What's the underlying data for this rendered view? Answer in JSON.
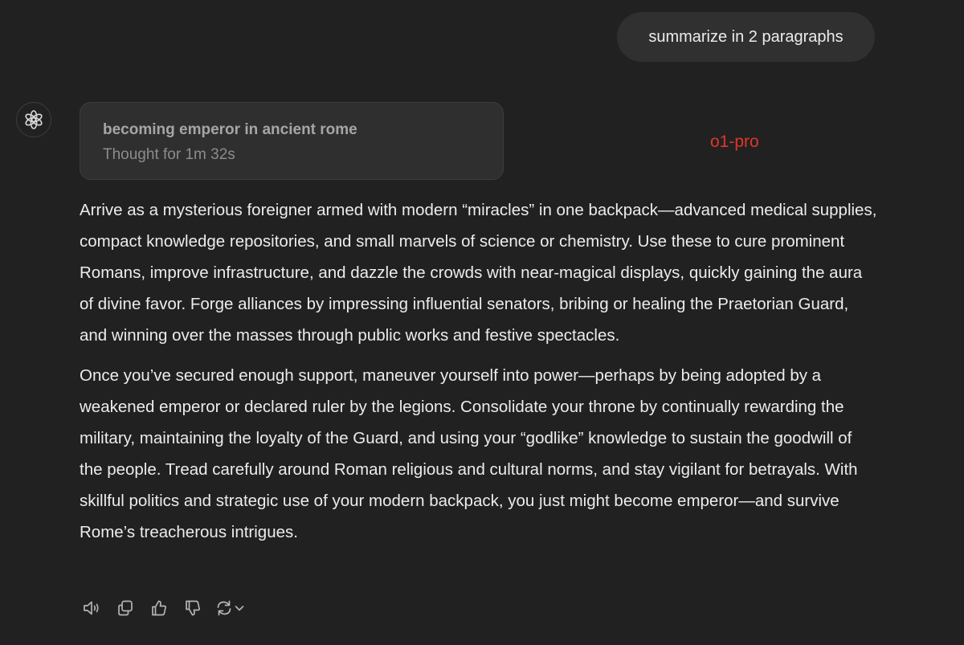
{
  "user_message": {
    "text": "summarize in 2 paragraphs"
  },
  "assistant": {
    "avatar_icon": "openai-logo-icon",
    "model_label": "o1-pro",
    "thought": {
      "title": "becoming emperor in ancient rome",
      "subtitle": "Thought for 1m 32s"
    },
    "paragraphs": [
      "Arrive as a mysterious foreigner armed with modern “miracles” in one backpack—advanced medical supplies, compact knowledge repositories, and small marvels of science or chemistry. Use these to cure prominent Romans, improve infrastructure, and dazzle the crowds with near-magical displays, quickly gaining the aura of divine favor. Forge alliances by impressing influential senators, bribing or healing the Praetorian Guard, and winning over the masses through public works and festive spectacles.",
      "Once you’ve secured enough support, maneuver yourself into power—perhaps by being adopted by a weakened emperor or declared ruler by the legions. Consolidate your throne by continually rewarding the military, maintaining the loyalty of the Guard, and using your “godlike” knowledge to sustain the goodwill of the people. Tread carefully around Roman religious and cultural norms, and stay vigilant for betrayals. With skillful politics and strategic use of your modern backpack, you just might become emperor—and survive Rome’s treacherous intrigues."
    ],
    "actions": [
      {
        "icon": "speaker-icon"
      },
      {
        "icon": "copy-icon"
      },
      {
        "icon": "thumbs-up-icon"
      },
      {
        "icon": "thumbs-down-icon"
      },
      {
        "icon": "regenerate-icon"
      }
    ]
  },
  "colors": {
    "background": "#212121",
    "bubble": "#303030",
    "card": "#2f2f2f",
    "text": "#ececec",
    "model_label": "#e0362b"
  }
}
